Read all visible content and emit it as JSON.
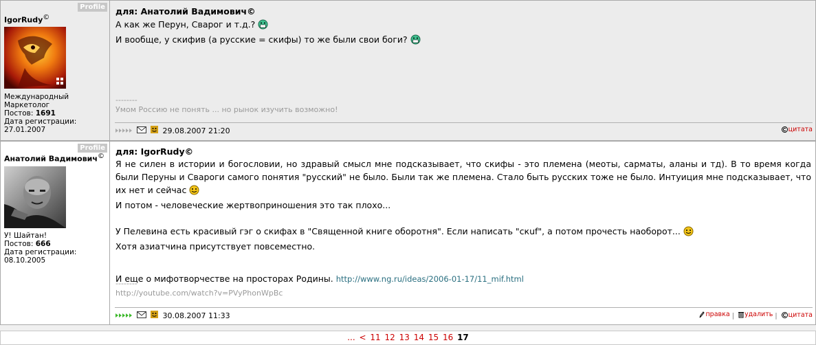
{
  "posts": [
    {
      "author": "IgorRudy",
      "author_mark": "©",
      "profile_label": "Profile",
      "meta": [
        "Международный",
        "Маркетолог"
      ],
      "posts_label": "Постов: ",
      "posts_count": "1691",
      "reg_label": "Дата регистрации:",
      "reg_date": "27.01.2007",
      "reply_to": "для: Анатолий Вадимович©",
      "lines": [
        "А как же Перун, Сварог и т.д.?",
        "И вообще, у скифив (а русские = скифы) то же были свои боги?"
      ],
      "sig_sep": "--------",
      "signature": "Умом Россию не понять ... но рынок изучить возможно!",
      "date": "29.08.2007 21:20",
      "actions": [
        "цитата"
      ]
    },
    {
      "author": "Анатолий Вадимович",
      "author_mark": "©",
      "profile_label": "Profile",
      "meta": [
        "У! Шайтан!"
      ],
      "posts_label": "Постов: ",
      "posts_count": "666",
      "reg_label": "Дата регистрации:",
      "reg_date": "08.10.2005",
      "reply_to": "для: IgorRudy©",
      "para1": "Я не силен в истории и богословии, но здравый смысл мне подсказывает, что скифы - это племена (меоты, сарматы, аланы и тд). В то время когда были Перуны и Свароги самого понятия \"русский\" не было. Были так же племена. Стало быть русских тоже не было. Интуиция мне подсказывает, что их нет и сейчас",
      "line2": "И потом - человеческие жертвоприношения это так плохо...",
      "line3": "У Пелевина есть красивый гэг о скифах в \"Священной книге оборотня\". Если написать \"скuf\", а потом прочесть наоборот...",
      "line4": "Хотя азиатчина присутствует повсеместно.",
      "line5": "И еще о мифотворчестве на просторах Родины.",
      "link": "http://www.ng.ru/ideas/2006-01-17/11_mif.html",
      "sig_sep": "--------",
      "signature": "http://youtube.com/watch?v=PVyPhonWpBc",
      "date": "30.08.2007 11:33",
      "actions": [
        "правка",
        "удалить",
        "цитата"
      ]
    }
  ],
  "pager": {
    "ellipsis": "...",
    "prev": "<",
    "pages": [
      "11",
      "12",
      "13",
      "14",
      "15",
      "16"
    ],
    "current": "17"
  },
  "colors": {
    "link_red": "#cc0000",
    "border": "#a9a9a9",
    "post_bg_odd": "#ececec"
  }
}
